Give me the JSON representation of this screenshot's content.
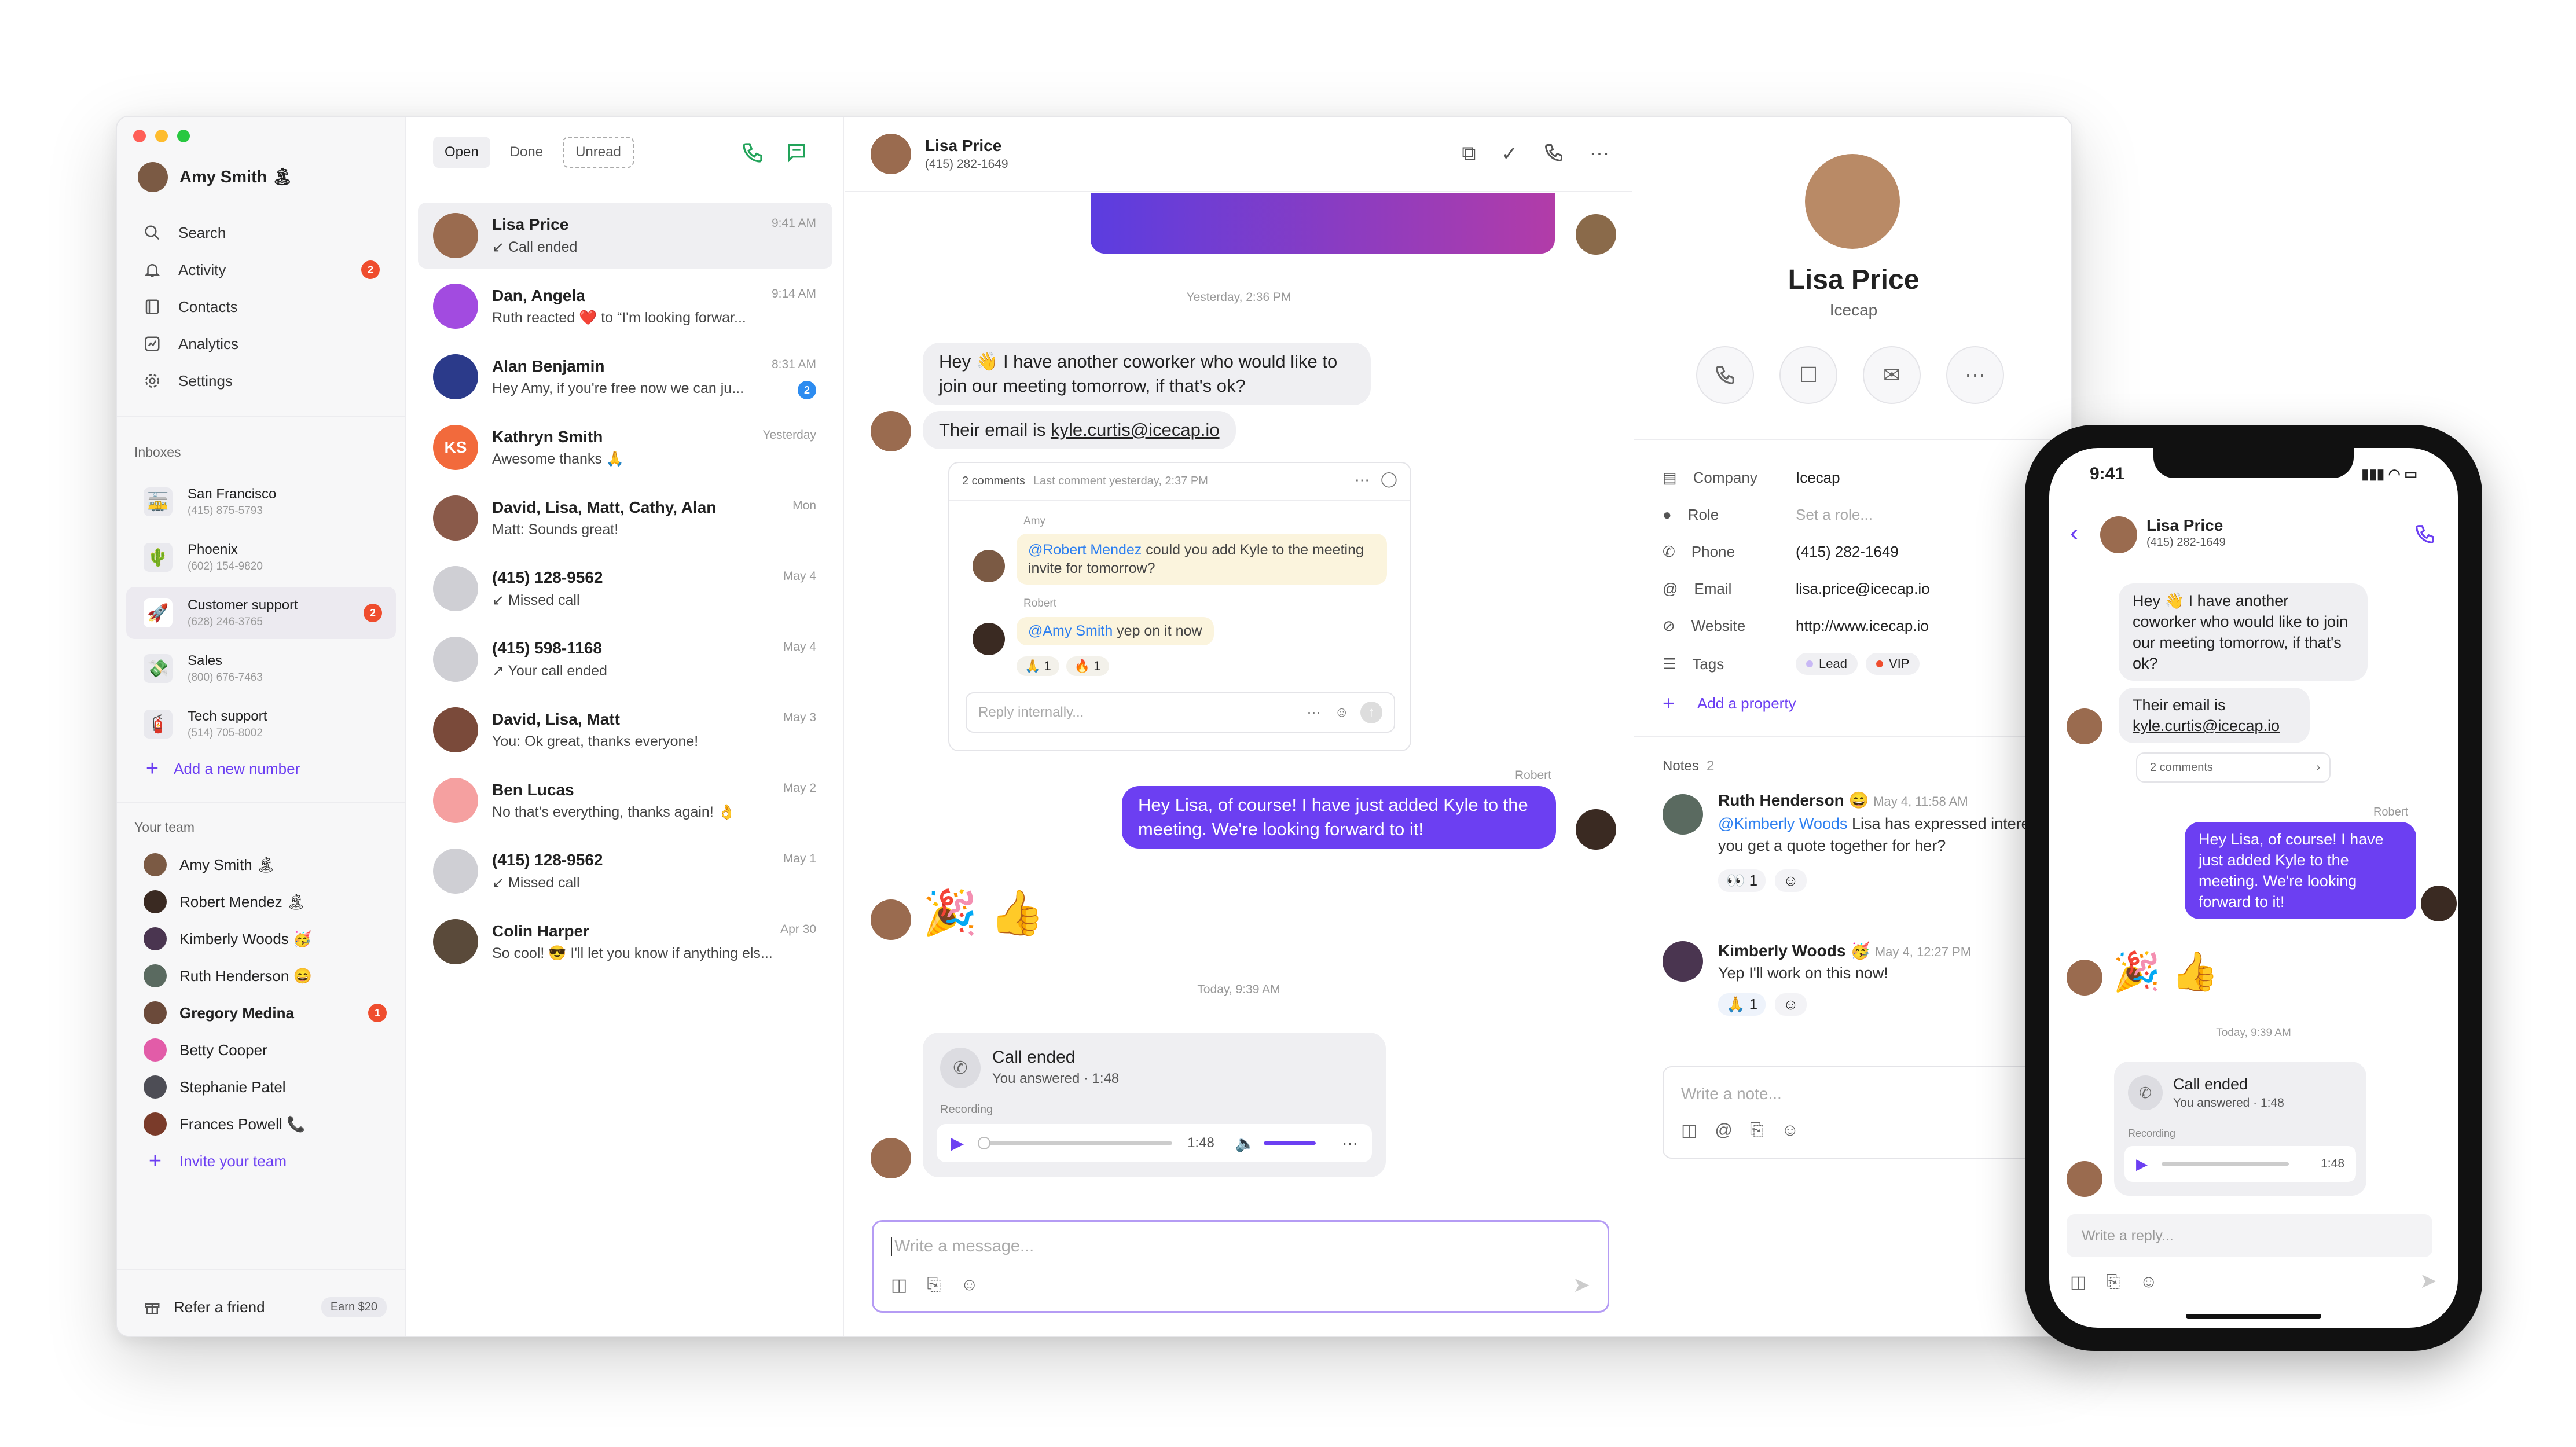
{
  "user": {
    "name": "Amy Smith 🏝"
  },
  "nav": [
    {
      "label": "Search",
      "icon": "search-icon"
    },
    {
      "label": "Activity",
      "icon": "bell-icon",
      "badge": "2"
    },
    {
      "label": "Contacts",
      "icon": "contacts-icon"
    },
    {
      "label": "Analytics",
      "icon": "analytics-icon"
    },
    {
      "label": "Settings",
      "icon": "gear-icon"
    }
  ],
  "inboxes": {
    "heading": "Inboxes",
    "items": [
      {
        "name": "San Francisco",
        "phone": "(415) 875-5793",
        "emoji": "🚋"
      },
      {
        "name": "Phoenix",
        "phone": "(602) 154-9820",
        "emoji": "🌵"
      },
      {
        "name": "Customer support",
        "phone": "(628) 246-3765",
        "emoji": "🚀",
        "badge": "2"
      },
      {
        "name": "Sales",
        "phone": "(800) 676-7463",
        "emoji": "💸"
      },
      {
        "name": "Tech support",
        "phone": "(514) 705-8002",
        "emoji": "🧯"
      }
    ],
    "add_label": "Add a new number"
  },
  "team": {
    "heading": "Your team",
    "members": [
      {
        "name": "Amy Smith 🏝",
        "color": "#7b5a44"
      },
      {
        "name": "Robert Mendez 🏝",
        "color": "#3a2a22"
      },
      {
        "name": "Kimberly Woods 🥳",
        "color": "#4a3550"
      },
      {
        "name": "Ruth Henderson 😄",
        "color": "#5a6a60"
      },
      {
        "name": "Gregory Medina",
        "color": "#6b4a3a",
        "badge": "1",
        "bold": true
      },
      {
        "name": "Betty Cooper",
        "color": "#e25ca8"
      },
      {
        "name": "Stephanie Patel",
        "color": "#4d4d55"
      },
      {
        "name": "Frances Powell 📞",
        "color": "#7a3b2a"
      }
    ],
    "invite_label": "Invite your team"
  },
  "refer": {
    "label": "Refer a friend",
    "earn": "Earn $20"
  },
  "tabs": {
    "open": "Open",
    "done": "Done",
    "unread": "Unread"
  },
  "conversations": [
    {
      "name": "Lisa Price",
      "preview": "↙ Call ended",
      "time": "9:41 AM",
      "color": "#9a6b4f"
    },
    {
      "name": "Dan, Angela",
      "preview": "Ruth reacted ❤️ to “I'm looking forwar...",
      "time": "9:14 AM",
      "color": "#a24be0"
    },
    {
      "name": "Alan Benjamin",
      "preview": "Hey Amy, if you're free now we can ju...",
      "time": "8:31 AM",
      "color": "#2b3a8a",
      "badge": "2"
    },
    {
      "name": "Kathryn Smith",
      "preview": "Awesome thanks 🙏",
      "time": "Yesterday",
      "color": "#f26a3c",
      "initials": "KS"
    },
    {
      "name": "David, Lisa, Matt, Cathy, Alan",
      "preview": "Matt: Sounds great!",
      "time": "Mon",
      "color": "#8a5a4a"
    },
    {
      "name": "(415) 128-9562",
      "preview": "↙ Missed call",
      "time": "May 4",
      "color": "#cfcfd4"
    },
    {
      "name": "(415) 598-1168",
      "preview": "↗ Your call ended",
      "time": "May 4",
      "color": "#cfcfd4"
    },
    {
      "name": "David, Lisa, Matt",
      "preview": "You: Ok great, thanks everyone!",
      "time": "May 3",
      "color": "#7a4a3a"
    },
    {
      "name": "Ben Lucas",
      "preview": "No that's everything, thanks again! 👌",
      "time": "May 2",
      "color": "#f5a0a0"
    },
    {
      "name": "(415) 128-9562",
      "preview": "↙ Missed call",
      "time": "May 1",
      "color": "#cfcfd4"
    },
    {
      "name": "Colin Harper",
      "preview": "So cool! 😎 I'll let you know if anything els...",
      "time": "Apr 30",
      "color": "#5a4a3a"
    }
  ],
  "chat": {
    "contact": "Lisa Price",
    "phone": "(415) 282-1649",
    "ts1": "Yesterday, 2:36 PM",
    "msg1": "Hey 👋 I have another coworker who would like to join our meeting tomorrow, if that's ok?",
    "msg2_prefix": "Their email is ",
    "msg2_link": "kyle.curtis@icecap.io",
    "thread": {
      "count": "2 comments",
      "last": "Last comment yesterday, 2:37 PM",
      "c1_author": "Amy",
      "c1_mention": "@Robert Mendez",
      "c1_text": " could you add Kyle to the meeting invite for tomorrow?",
      "c2_author": "Robert",
      "c2_mention": "@Amy Smith",
      "c2_text": " yep on it now",
      "r1": "🙏 1",
      "r2": "🔥 1",
      "reply_placeholder": "Reply internally..."
    },
    "out_author": "Robert",
    "out_msg": "Hey Lisa, of course! I have just added Kyle to the meeting. We're looking forward to it!",
    "emoji_msg": "🎉 👍",
    "ts2": "Today, 9:39 AM",
    "call": {
      "title": "Call ended",
      "sub": "You answered · 1:48",
      "rec": "Recording",
      "dur": "1:48"
    },
    "composer_placeholder": "Write a message..."
  },
  "contact": {
    "name": "Lisa Price",
    "company": "Icecap",
    "props": [
      {
        "key": "Company",
        "value": "Icecap",
        "icon": "building-icon"
      },
      {
        "key": "Role",
        "value": "Set a role...",
        "icon": "person-icon",
        "muted": true
      },
      {
        "key": "Phone",
        "value": "(415) 282-1649",
        "icon": "phone-icon"
      },
      {
        "key": "Email",
        "value": "lisa.price@icecap.io",
        "icon": "at-icon"
      },
      {
        "key": "Website",
        "value": "http://www.icecap.io",
        "icon": "link-icon"
      }
    ],
    "tags_key": "Tags",
    "tags": [
      {
        "label": "Lead",
        "color": "#c8b8f5"
      },
      {
        "label": "VIP",
        "color": "#ef4d2e"
      }
    ],
    "add_prop": "Add a property",
    "notes_label": "Notes",
    "notes_count": "2",
    "note1": {
      "author": "Ruth Henderson 😄",
      "time": "May 4, 11:58 AM",
      "mention": "@Kimberly Woods",
      "text": " Lisa has expressed interest in upgrading to Enterprise. Cou",
      "text2": "you get a quote together for her?",
      "react": "👀 1"
    },
    "note2": {
      "author": "Kimberly Woods 🥳",
      "time": "May 4, 12:27 PM",
      "text": "Yep I'll work on this now!",
      "react": "🙏 1"
    },
    "note_placeholder": "Write a note..."
  },
  "phone": {
    "time": "9:41",
    "contact": "Lisa Price",
    "number": "(415) 282-1649",
    "msg1": "Hey 👋 I have another coworker who would like to join our meeting tomorrow, if that's ok?",
    "msg2_prefix": "Their email is ",
    "msg2_link": "kyle.curtis@icecap.io",
    "comments": "2 comments",
    "out_author": "Robert",
    "out_msg": "Hey Lisa, of course! I have just added Kyle to the meeting. We're looking forward to it!",
    "emoji_msg": "🎉 👍",
    "ts": "Today, 9:39 AM",
    "call_title": "Call ended",
    "call_sub": "You answered · 1:48",
    "rec": "Recording",
    "dur": "1:48",
    "reply_placeholder": "Write a reply..."
  }
}
